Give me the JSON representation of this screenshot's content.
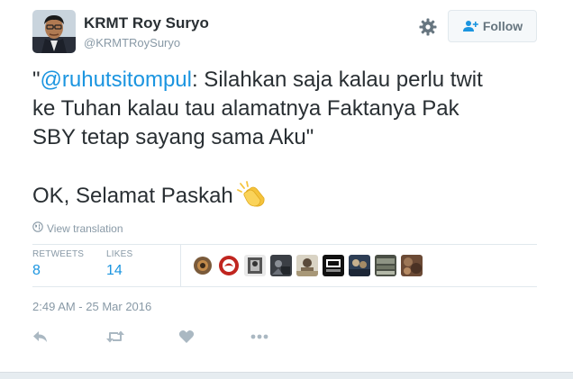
{
  "author": {
    "fullname": "KRMT Roy Suryo",
    "username": "@KRMTRoySuryo"
  },
  "header": {
    "follow_label": "Follow",
    "settings_icon": "gear-icon"
  },
  "tweet": {
    "quote_open": "\"",
    "mention": "@ruhutsitompul",
    "line1_rest": ": Silahkan saja kalau perlu twit",
    "line2": "ke Tuhan kalau tau alamatnya Faktanya Pak",
    "line3": "SBY tetap sayang sama Aku\"",
    "line4": "OK, Selamat Paskah",
    "emoji": "clapping-hands",
    "translate_label": "View translation"
  },
  "stats": {
    "retweets_label": "RETWEETS",
    "retweets_value": "8",
    "likes_label": "LIKES",
    "likes_value": "14"
  },
  "likers": [
    {
      "name": "liker-1"
    },
    {
      "name": "liker-2"
    },
    {
      "name": "liker-3"
    },
    {
      "name": "liker-4"
    },
    {
      "name": "liker-5"
    },
    {
      "name": "liker-6"
    },
    {
      "name": "liker-7"
    },
    {
      "name": "liker-8"
    },
    {
      "name": "liker-9"
    }
  ],
  "timestamp": "2:49 AM - 25 Mar 2016",
  "actions": [
    "reply-icon",
    "retweet-icon",
    "like-icon",
    "more-icon"
  ],
  "colors": {
    "link": "#1b95e0",
    "text": "#292f33",
    "muted": "#8899a6",
    "border": "#e1e8ed",
    "emoji": "#f5c33b"
  }
}
